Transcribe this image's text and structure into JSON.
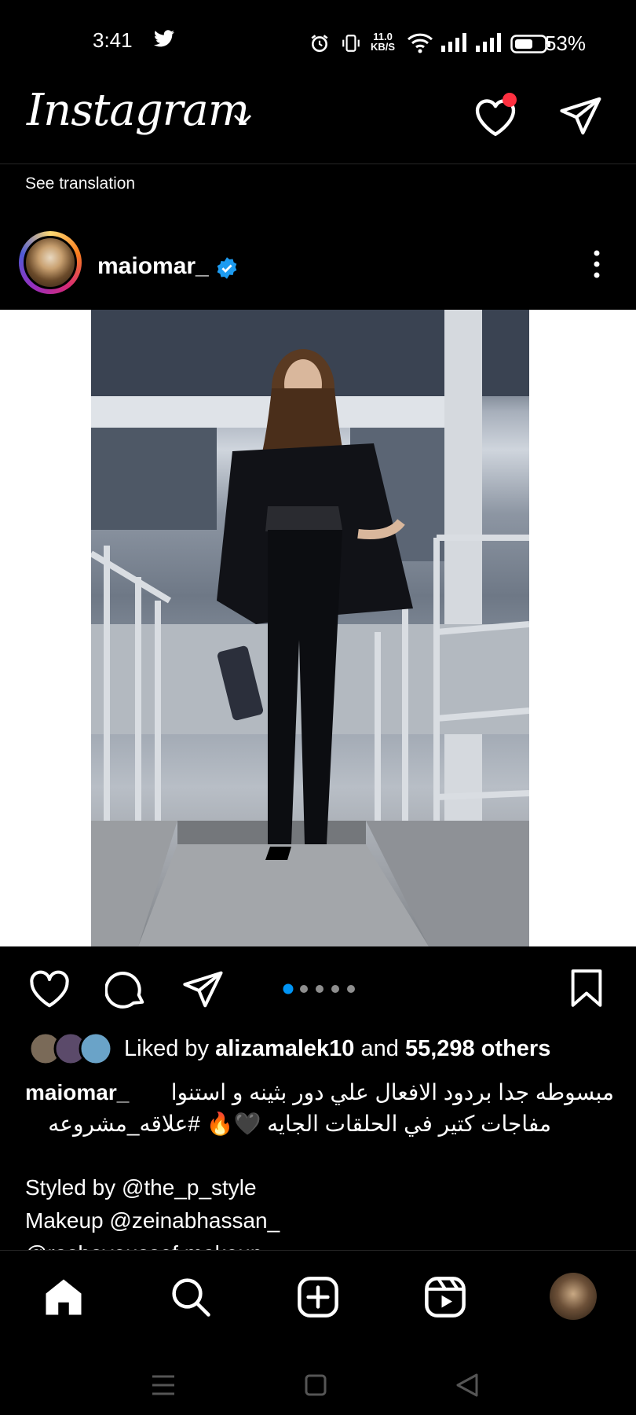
{
  "status_bar": {
    "time": "3:41",
    "network_speed_value": "11.0",
    "network_speed_unit": "KB/S",
    "battery_percent": "53%",
    "icons": [
      "twitter-icon",
      "alarm-icon",
      "vibrate-icon",
      "wifi-icon",
      "signal-icon",
      "signal-icon-2",
      "battery-icon"
    ]
  },
  "header": {
    "logo_text": "Instagram",
    "notification_dot_color": "#ff3040"
  },
  "see_translation": "See translation",
  "post": {
    "username": "maiomar_",
    "verified_color": "#1d9bf0",
    "carousel": {
      "count": 5,
      "active_index": 0,
      "active_color": "#0095f6"
    }
  },
  "likes": {
    "prefix": "Liked by ",
    "liker": "alizamalek10",
    "middle": " and ",
    "others": "55,298 others"
  },
  "caption": {
    "username": "maiomar_",
    "line1": "مبسوطه جدا بردود الافعال علي دور بثينه و استنوا",
    "line2": "مفاجات كتير في الحلقات الجايه 🖤🔥 #علاقه_مشروعه"
  },
  "credits": {
    "styled": "Styled by @the_p_style",
    "makeup": "Makeup @zeinabhassan_",
    "partial": "@rashayoussef.makeup"
  },
  "bottom_nav": [
    "home-icon",
    "search-icon",
    "create-icon",
    "reels-icon",
    "profile-avatar"
  ]
}
